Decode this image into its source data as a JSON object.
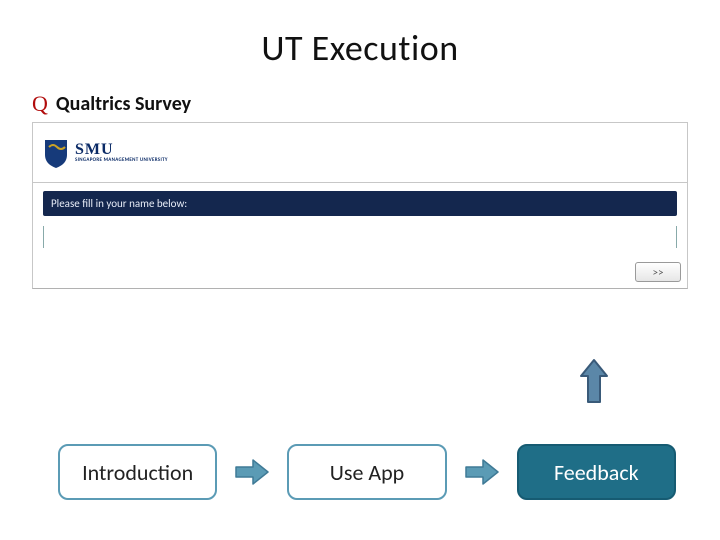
{
  "title": "UT Execution",
  "q_mark": "Q",
  "q_label": "Qualtrics Survey",
  "logo": {
    "brand": "SMU",
    "sub": "SINGAPORE MANAGEMENT UNIVERSITY"
  },
  "survey": {
    "prompt": "Please fill in your name below:",
    "name_value": "",
    "next_label": ">>"
  },
  "flow": {
    "steps": [
      "Introduction",
      "Use App",
      "Feedback"
    ]
  },
  "colors": {
    "arrow_fill": "#5b87a8",
    "arrow_stroke": "#3f6a8c",
    "up_fill": "#5b87a8",
    "up_stroke": "#395a79"
  }
}
